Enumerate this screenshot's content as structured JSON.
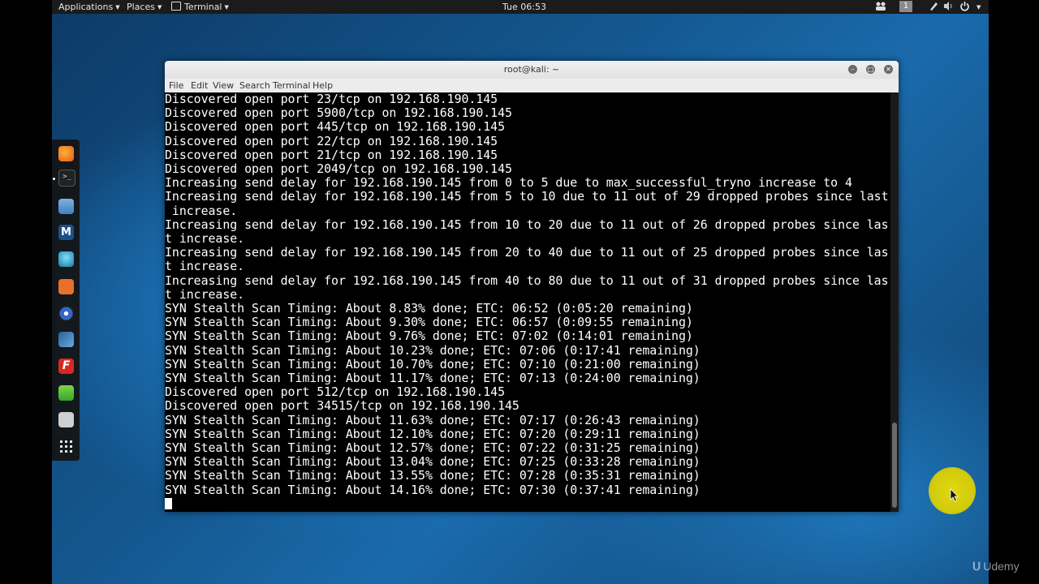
{
  "topbar": {
    "applications": "Applications",
    "places": "Places",
    "terminal": "Terminal",
    "clock": "Tue 06:53",
    "workspace": "1"
  },
  "dock": {
    "items": [
      "firefox-icon",
      "terminal-icon",
      "files-icon",
      "metasploit-icon",
      "armitage-icon",
      "burpsuite-icon",
      "maltego-icon",
      "beef-icon",
      "faraday-icon",
      "leafpad-icon",
      "screenshot-icon",
      "show-apps-icon"
    ]
  },
  "window": {
    "title": "root@kali: ~",
    "menu": [
      "File",
      "Edit",
      "View",
      "Search",
      "Terminal",
      "Help"
    ]
  },
  "terminal": {
    "lines": [
      "Discovered open port 23/tcp on 192.168.190.145",
      "Discovered open port 5900/tcp on 192.168.190.145",
      "Discovered open port 445/tcp on 192.168.190.145",
      "Discovered open port 22/tcp on 192.168.190.145",
      "Discovered open port 21/tcp on 192.168.190.145",
      "Discovered open port 2049/tcp on 192.168.190.145",
      "Increasing send delay for 192.168.190.145 from 0 to 5 due to max_successful_tryno increase to 4",
      "Increasing send delay for 192.168.190.145 from 5 to 10 due to 11 out of 29 dropped probes since last",
      " increase.",
      "Increasing send delay for 192.168.190.145 from 10 to 20 due to 11 out of 26 dropped probes since las",
      "t increase.",
      "Increasing send delay for 192.168.190.145 from 20 to 40 due to 11 out of 25 dropped probes since las",
      "t increase.",
      "Increasing send delay for 192.168.190.145 from 40 to 80 due to 11 out of 31 dropped probes since las",
      "t increase.",
      "SYN Stealth Scan Timing: About 8.83% done; ETC: 06:52 (0:05:20 remaining)",
      "SYN Stealth Scan Timing: About 9.30% done; ETC: 06:57 (0:09:55 remaining)",
      "SYN Stealth Scan Timing: About 9.76% done; ETC: 07:02 (0:14:01 remaining)",
      "SYN Stealth Scan Timing: About 10.23% done; ETC: 07:06 (0:17:41 remaining)",
      "SYN Stealth Scan Timing: About 10.70% done; ETC: 07:10 (0:21:00 remaining)",
      "SYN Stealth Scan Timing: About 11.17% done; ETC: 07:13 (0:24:00 remaining)",
      "Discovered open port 512/tcp on 192.168.190.145",
      "Discovered open port 34515/tcp on 192.168.190.145",
      "SYN Stealth Scan Timing: About 11.63% done; ETC: 07:17 (0:26:43 remaining)",
      "SYN Stealth Scan Timing: About 12.10% done; ETC: 07:20 (0:29:11 remaining)",
      "SYN Stealth Scan Timing: About 12.57% done; ETC: 07:22 (0:31:25 remaining)",
      "SYN Stealth Scan Timing: About 13.04% done; ETC: 07:25 (0:33:28 remaining)",
      "SYN Stealth Scan Timing: About 13.55% done; ETC: 07:28 (0:35:31 remaining)",
      "SYN Stealth Scan Timing: About 14.16% done; ETC: 07:30 (0:37:41 remaining)"
    ]
  },
  "watermark": "Udemy",
  "colors": {
    "panel": "#1b1b1b",
    "terminal_bg": "#000000",
    "terminal_fg": "#ffffff",
    "highlight": "#f2e200"
  }
}
